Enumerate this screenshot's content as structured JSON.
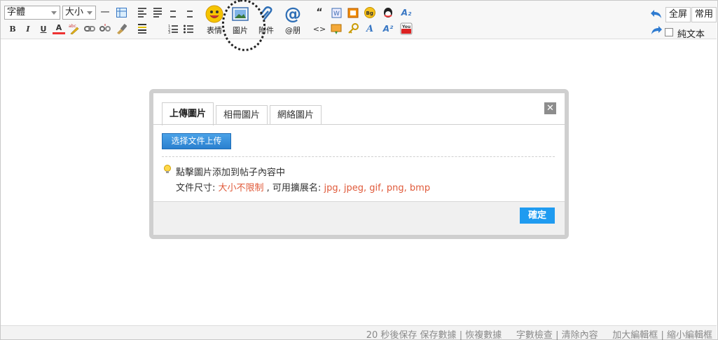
{
  "toolbar": {
    "font_select": "字體",
    "size_select": "大小",
    "big_buttons": {
      "emoticon": "表情",
      "image": "圖片",
      "attachment": "附件",
      "mention": "@朋"
    },
    "right": {
      "fullscreen": "全屏",
      "common": "常用",
      "plaintext": "純文本"
    },
    "glyphs": {
      "quote": "“",
      "code": "<>",
      "bold": "B",
      "italic": "I",
      "underline": "U",
      "fontcolor": "A",
      "hr": "一",
      "bg": "Bg",
      "sup": "A²",
      "sub": "A₂",
      "youtube": "You",
      "at": "@"
    }
  },
  "dialog": {
    "tabs": [
      "上傳圖片",
      "相冊圖片",
      "網絡圖片"
    ],
    "close": "✕",
    "upload_button": "选择文件上传",
    "tip_line1": "點擊圖片添加到帖子內容中",
    "tip_size_label": "文件尺寸: ",
    "tip_size_value": "大小不限制",
    "tip_ext_label": " , 可用擴展名: ",
    "tip_ext_value": "jpg, jpeg, gif, png, bmp",
    "ok_button": "確定"
  },
  "status_bar": {
    "autosave": "20 秒後保存",
    "save": "保存數據",
    "restore": "恢複數據",
    "wordcount": "字數檢查",
    "clear": "清除內容",
    "enlarge": "加大編輯框",
    "shrink": "縮小編輯框",
    "sep": "|"
  },
  "colors": {
    "accent": "#1f9bf0",
    "warning": "#e05a3a"
  }
}
